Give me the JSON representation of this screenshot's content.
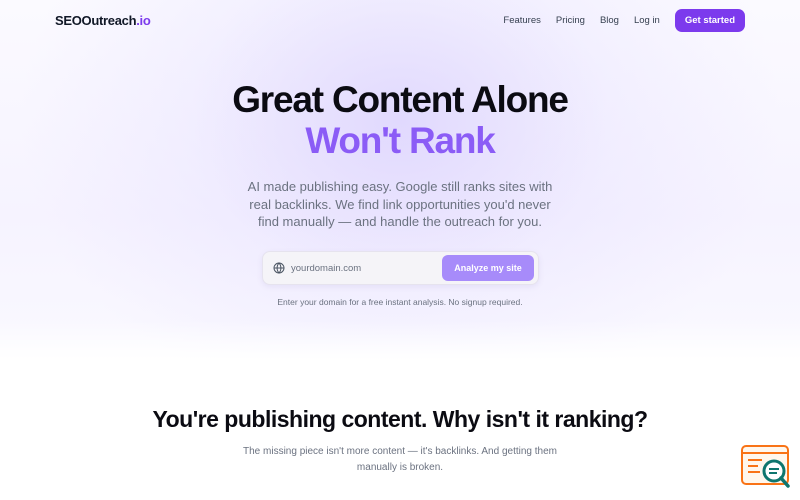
{
  "brand": {
    "name": "SEOOutreach",
    "tld": ".io"
  },
  "nav": {
    "links": [
      "Features",
      "Pricing",
      "Blog",
      "Log in"
    ],
    "cta_label": "Get started"
  },
  "hero": {
    "title_line1": "Great Content Alone",
    "title_line2": "Won't Rank",
    "subtitle": "AI made publishing easy. Google still ranks sites with real backlinks. We find link opportunities you'd never find manually — and handle the outreach for you.",
    "input_placeholder": "yourdomain.com",
    "input_value": "",
    "analyze_label": "Analyze my site",
    "hint": "Enter your domain for a free instant analysis. No signup required."
  },
  "problem": {
    "title": "You're publishing content. Why isn't it ranking?",
    "subtitle": "The missing piece isn't more content — it's backlinks. And getting them manually is broken."
  },
  "icons": {
    "input": "globe-icon",
    "widget": "search-chat-icon"
  },
  "colors": {
    "accent": "#7c3aed",
    "accent_light": "#8b5cf6",
    "button_muted": "#a78bfa",
    "widget": "#f97316"
  }
}
